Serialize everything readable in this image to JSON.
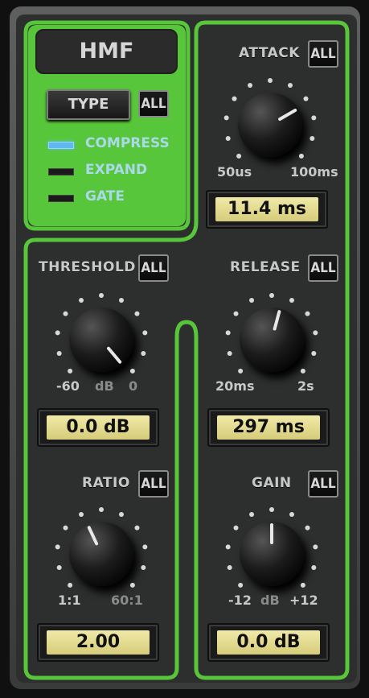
{
  "band_title": "HMF",
  "type_section": {
    "type_label": "TYPE",
    "all_label": "ALL",
    "modes": [
      {
        "label": "COMPRESS",
        "active": true
      },
      {
        "label": "EXPAND",
        "active": false
      },
      {
        "label": "GATE",
        "active": false
      }
    ]
  },
  "attack": {
    "label": "ATTACK",
    "all": "ALL",
    "min": "50us",
    "max": "100ms",
    "value": "11.4 ms"
  },
  "threshold": {
    "label": "THRESHOLD",
    "all": "ALL",
    "min": "-60",
    "unit": "dB",
    "max": "0",
    "value": "0.0 dB"
  },
  "release": {
    "label": "RELEASE",
    "all": "ALL",
    "min": "20ms",
    "max": "2s",
    "value": "297 ms"
  },
  "ratio": {
    "label": "RATIO",
    "all": "ALL",
    "min": "1:1",
    "max": "60:1",
    "value": "2.00"
  },
  "gain": {
    "label": "GAIN",
    "all": "ALL",
    "min": "-12",
    "unit": "dB",
    "max": "+12",
    "value": "0.0 dB"
  },
  "colors": {
    "accent_green": "#58c63a",
    "led_active": "#5fb8f0",
    "display_bg": "#e8e09a"
  }
}
